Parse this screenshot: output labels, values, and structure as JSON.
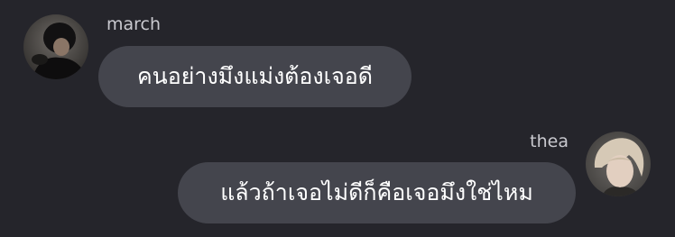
{
  "messages": [
    {
      "sender": "march",
      "text": "คนอย่างมึงแม่งต้องเจอดี",
      "avatar_icon": "person-dark-photo-icon"
    },
    {
      "sender": "thea",
      "text": "แล้วถ้าเจอไม่ดีก็คือเจอมึงใช่ไหม",
      "avatar_icon": "person-blond-photo-icon"
    }
  ],
  "colors": {
    "background": "#25252b",
    "bubble": "#44454d",
    "name_text": "#c9c9cf",
    "message_text": "#ffffff"
  }
}
